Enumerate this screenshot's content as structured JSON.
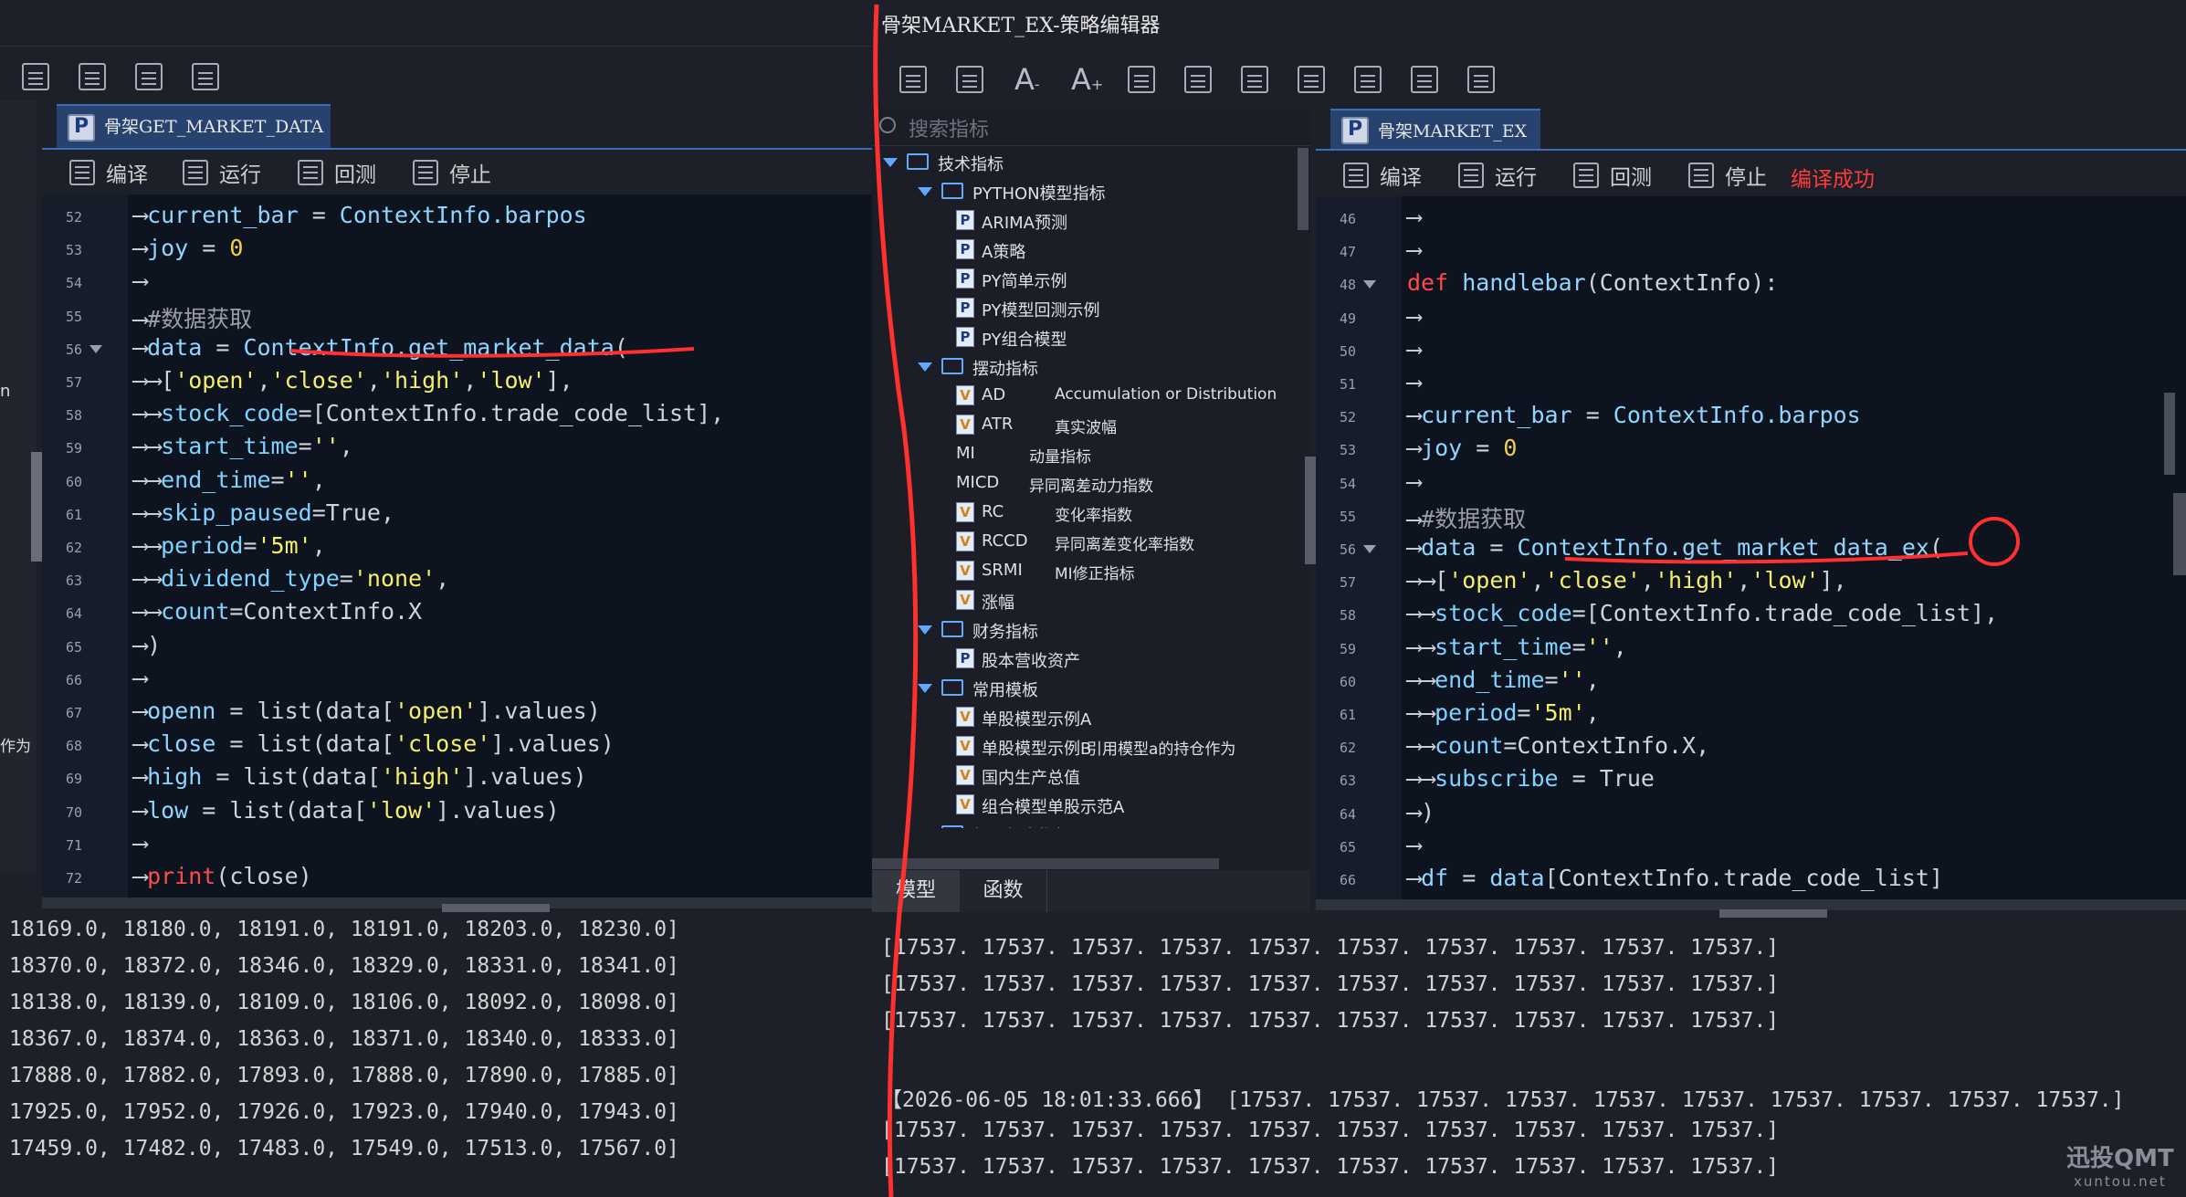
{
  "left_window": {
    "tab_label": "骨架GET_MARKET_DATA",
    "toolbar": [
      "编译",
      "运行",
      "回测",
      "停止"
    ],
    "side_fragments": [
      "n",
      "作为"
    ],
    "code_lines": [
      {
        "n": "52",
        "t": [
          [
            "arr",
            "⟶"
          ],
          [
            "var",
            "current_bar"
          ],
          [
            "",
            " = "
          ],
          [
            "var",
            "ContextInfo.barpos"
          ]
        ]
      },
      {
        "n": "53",
        "t": [
          [
            "arr",
            "⟶"
          ],
          [
            "var",
            "joy"
          ],
          [
            "",
            " = "
          ],
          [
            "num",
            "0"
          ]
        ]
      },
      {
        "n": "54",
        "t": [
          [
            "arr",
            "⟶"
          ]
        ]
      },
      {
        "n": "55",
        "t": [
          [
            "arr",
            "⟶"
          ],
          [
            "cmt",
            "#数据获取"
          ]
        ]
      },
      {
        "n": "56",
        "t": [
          [
            "arr",
            "⟶"
          ],
          [
            "var",
            "data"
          ],
          [
            "",
            " = "
          ],
          [
            "fn",
            "ContextInfo.get_market_data"
          ],
          [
            "",
            "("
          ]
        ]
      },
      {
        "n": "57",
        "t": [
          [
            "arr",
            "⟶⟶"
          ],
          [
            "",
            "["
          ],
          [
            "str",
            "'open'"
          ],
          [
            "",
            ","
          ],
          [
            "str",
            "'close'"
          ],
          [
            "",
            ","
          ],
          [
            "str",
            "'high'"
          ],
          [
            "",
            ","
          ],
          [
            "str",
            "'low'"
          ],
          [
            "",
            "],"
          ]
        ]
      },
      {
        "n": "58",
        "t": [
          [
            "arr",
            "⟶⟶"
          ],
          [
            "prm",
            "stock_code"
          ],
          [
            "",
            "=[ContextInfo.trade_code_list],"
          ]
        ]
      },
      {
        "n": "59",
        "t": [
          [
            "arr",
            "⟶⟶"
          ],
          [
            "prm",
            "start_time"
          ],
          [
            "",
            "="
          ],
          [
            "str",
            "''"
          ],
          [
            "",
            ","
          ]
        ]
      },
      {
        "n": "60",
        "t": [
          [
            "arr",
            "⟶⟶"
          ],
          [
            "prm",
            "end_time"
          ],
          [
            "",
            "="
          ],
          [
            "str",
            "''"
          ],
          [
            "",
            ","
          ]
        ]
      },
      {
        "n": "61",
        "t": [
          [
            "arr",
            "⟶⟶"
          ],
          [
            "prm",
            "skip_paused"
          ],
          [
            "",
            "=True,"
          ]
        ]
      },
      {
        "n": "62",
        "t": [
          [
            "arr",
            "⟶⟶"
          ],
          [
            "prm",
            "period"
          ],
          [
            "",
            "="
          ],
          [
            "str",
            "'5m'"
          ],
          [
            "",
            ","
          ]
        ]
      },
      {
        "n": "63",
        "t": [
          [
            "arr",
            "⟶⟶"
          ],
          [
            "prm",
            "dividend_type"
          ],
          [
            "",
            "="
          ],
          [
            "str",
            "'none'"
          ],
          [
            "",
            ","
          ]
        ]
      },
      {
        "n": "64",
        "t": [
          [
            "arr",
            "⟶⟶"
          ],
          [
            "prm",
            "count"
          ],
          [
            "",
            "=ContextInfo.X"
          ]
        ]
      },
      {
        "n": "65",
        "t": [
          [
            "arr",
            "⟶"
          ],
          [
            "",
            ")"
          ]
        ]
      },
      {
        "n": "66",
        "t": [
          [
            "arr",
            "⟶"
          ]
        ]
      },
      {
        "n": "67",
        "t": [
          [
            "arr",
            "⟶"
          ],
          [
            "var",
            "openn"
          ],
          [
            "",
            " = list(data["
          ],
          [
            "str",
            "'open'"
          ],
          [
            "",
            "].values)"
          ]
        ]
      },
      {
        "n": "68",
        "t": [
          [
            "arr",
            "⟶"
          ],
          [
            "var",
            "close"
          ],
          [
            "",
            " = list(data["
          ],
          [
            "str",
            "'close'"
          ],
          [
            "",
            "].values)"
          ]
        ]
      },
      {
        "n": "69",
        "t": [
          [
            "arr",
            "⟶"
          ],
          [
            "var",
            "high"
          ],
          [
            "",
            " = list(data["
          ],
          [
            "str",
            "'high'"
          ],
          [
            "",
            "].values)"
          ]
        ]
      },
      {
        "n": "70",
        "t": [
          [
            "arr",
            "⟶"
          ],
          [
            "var",
            "low"
          ],
          [
            "",
            " = list(data["
          ],
          [
            "str",
            "'low'"
          ],
          [
            "",
            "].values)"
          ]
        ]
      },
      {
        "n": "71",
        "t": [
          [
            "arr",
            "⟶"
          ]
        ]
      },
      {
        "n": "72",
        "t": [
          [
            "arr",
            "⟶"
          ],
          [
            "kw",
            "print"
          ],
          [
            "",
            "(close)"
          ]
        ]
      }
    ],
    "output": [
      "18169.0, 18180.0, 18191.0, 18191.0, 18203.0, 18230.0]",
      "18370.0, 18372.0, 18346.0, 18329.0, 18331.0, 18341.0]",
      "18138.0, 18139.0, 18109.0, 18106.0, 18092.0, 18098.0]",
      "18367.0, 18374.0, 18363.0, 18371.0, 18340.0, 18333.0]",
      "17888.0, 17882.0, 17893.0, 17888.0, 17890.0, 17885.0]",
      "17925.0, 17952.0, 17926.0, 17923.0, 17940.0, 17943.0]",
      "17459.0, 17482.0, 17483.0, 17549.0, 17513.0, 17567.0]"
    ]
  },
  "right_window": {
    "title": "骨架MARKET_EX-策略编辑器",
    "search_placeholder": "搜索指标",
    "tab_label": "骨架MARKET_EX",
    "toolbar": [
      "编译",
      "运行",
      "回测",
      "停止"
    ],
    "compile_status": "编译成功",
    "tree": [
      {
        "level": 0,
        "type": "folder",
        "label": "技术指标"
      },
      {
        "level": 1,
        "type": "folder",
        "label": "PYTHON模型指标"
      },
      {
        "level": 2,
        "type": "p",
        "label": "ARIMA预测"
      },
      {
        "level": 2,
        "type": "p",
        "label": "A策略"
      },
      {
        "level": 2,
        "type": "p",
        "label": "PY简单示例"
      },
      {
        "level": 2,
        "type": "p",
        "label": "PY模型回测示例"
      },
      {
        "level": 2,
        "type": "p",
        "label": "PY组合模型"
      },
      {
        "level": 1,
        "type": "folder",
        "label": "摆动指标"
      },
      {
        "level": 2,
        "type": "v",
        "label": "AD",
        "desc": "Accumulation or Distribution"
      },
      {
        "level": 2,
        "type": "v",
        "label": "ATR",
        "desc": "真实波幅"
      },
      {
        "level": 2,
        "type": "none",
        "label": "MI",
        "desc": "动量指标"
      },
      {
        "level": 2,
        "type": "none",
        "label": "MICD",
        "desc": "异同离差动力指数"
      },
      {
        "level": 2,
        "type": "v",
        "label": "RC",
        "desc": "变化率指数"
      },
      {
        "level": 2,
        "type": "v",
        "label": "RCCD",
        "desc": "异同离差变化率指数"
      },
      {
        "level": 2,
        "type": "v",
        "label": "SRMI",
        "desc": "MI修正指标"
      },
      {
        "level": 2,
        "type": "v",
        "label": "涨幅"
      },
      {
        "level": 1,
        "type": "folder",
        "label": "财务指标"
      },
      {
        "level": 2,
        "type": "p",
        "label": "股本营收资产"
      },
      {
        "level": 1,
        "type": "folder",
        "label": "常用模板"
      },
      {
        "level": 2,
        "type": "v",
        "label": "单股模型示例A"
      },
      {
        "level": 2,
        "type": "v",
        "label": "单股模型示例B",
        "desc": "引用模型a的持仓作为"
      },
      {
        "level": 2,
        "type": "v",
        "label": "国内生产总值"
      },
      {
        "level": 2,
        "type": "v",
        "label": "组合模型单股示范A"
      },
      {
        "level": 1,
        "type": "folder",
        "label": "超买超卖指标"
      }
    ],
    "bottom_tabs": [
      "模型",
      "函数"
    ],
    "code_lines": [
      {
        "n": "46",
        "t": [
          [
            "arr",
            "⟶"
          ]
        ]
      },
      {
        "n": "47",
        "t": [
          [
            "arr",
            "⟶"
          ]
        ]
      },
      {
        "n": "48",
        "t": [
          [
            "kw",
            "def"
          ],
          [
            "",
            " "
          ],
          [
            "fn",
            "handlebar"
          ],
          [
            "",
            "(ContextInfo):"
          ]
        ]
      },
      {
        "n": "49",
        "t": [
          [
            "arr",
            "⟶"
          ]
        ]
      },
      {
        "n": "50",
        "t": [
          [
            "arr",
            "⟶"
          ]
        ]
      },
      {
        "n": "51",
        "t": [
          [
            "arr",
            "⟶"
          ]
        ]
      },
      {
        "n": "52",
        "t": [
          [
            "arr",
            "⟶"
          ],
          [
            "var",
            "current_bar"
          ],
          [
            "",
            " = "
          ],
          [
            "var",
            "ContextInfo.barpos"
          ]
        ]
      },
      {
        "n": "53",
        "t": [
          [
            "arr",
            "⟶"
          ],
          [
            "var",
            "joy"
          ],
          [
            "",
            " = "
          ],
          [
            "num",
            "0"
          ]
        ]
      },
      {
        "n": "54",
        "t": [
          [
            "arr",
            "⟶"
          ]
        ]
      },
      {
        "n": "55",
        "t": [
          [
            "arr",
            "⟶"
          ],
          [
            "cmt",
            "#数据获取"
          ]
        ]
      },
      {
        "n": "56",
        "t": [
          [
            "arr",
            "⟶"
          ],
          [
            "var",
            "data"
          ],
          [
            "",
            " = "
          ],
          [
            "fn",
            "ContextInfo.get_market_data_ex"
          ],
          [
            "",
            "("
          ]
        ]
      },
      {
        "n": "57",
        "t": [
          [
            "arr",
            "⟶⟶"
          ],
          [
            "",
            "["
          ],
          [
            "str",
            "'open'"
          ],
          [
            "",
            ","
          ],
          [
            "str",
            "'close'"
          ],
          [
            "",
            ","
          ],
          [
            "str",
            "'high'"
          ],
          [
            "",
            ","
          ],
          [
            "str",
            "'low'"
          ],
          [
            "",
            "],"
          ]
        ]
      },
      {
        "n": "58",
        "t": [
          [
            "arr",
            "⟶⟶"
          ],
          [
            "prm",
            "stock_code"
          ],
          [
            "",
            "=[ContextInfo.trade_code_list],"
          ]
        ]
      },
      {
        "n": "59",
        "t": [
          [
            "arr",
            "⟶⟶"
          ],
          [
            "prm",
            "start_time"
          ],
          [
            "",
            "="
          ],
          [
            "str",
            "''"
          ],
          [
            "",
            ","
          ]
        ]
      },
      {
        "n": "60",
        "t": [
          [
            "arr",
            "⟶⟶"
          ],
          [
            "prm",
            "end_time"
          ],
          [
            "",
            "="
          ],
          [
            "str",
            "''"
          ],
          [
            "",
            ","
          ]
        ]
      },
      {
        "n": "61",
        "t": [
          [
            "arr",
            "⟶⟶"
          ],
          [
            "prm",
            "period"
          ],
          [
            "",
            "="
          ],
          [
            "str",
            "'5m'"
          ],
          [
            "",
            ","
          ]
        ]
      },
      {
        "n": "62",
        "t": [
          [
            "arr",
            "⟶⟶"
          ],
          [
            "prm",
            "count"
          ],
          [
            "",
            "=ContextInfo.X,"
          ]
        ]
      },
      {
        "n": "63",
        "t": [
          [
            "arr",
            "⟶⟶"
          ],
          [
            "prm",
            "subscribe"
          ],
          [
            "",
            " = True"
          ]
        ]
      },
      {
        "n": "64",
        "t": [
          [
            "arr",
            "⟶"
          ],
          [
            "",
            ")"
          ]
        ]
      },
      {
        "n": "65",
        "t": [
          [
            "arr",
            "⟶"
          ]
        ]
      },
      {
        "n": "66",
        "t": [
          [
            "arr",
            "⟶"
          ],
          [
            "var",
            "df"
          ],
          [
            "",
            " = "
          ],
          [
            "var",
            "data"
          ],
          [
            "",
            "[ContextInfo.trade_code_list]"
          ]
        ]
      }
    ],
    "output": [
      "[17537. 17537. 17537. 17537. 17537. 17537. 17537. 17537. 17537. 17537.]",
      "[17537. 17537. 17537. 17537. 17537. 17537. 17537. 17537. 17537. 17537.]",
      "[17537. 17537. 17537. 17537. 17537. 17537. 17537. 17537. 17537. 17537.]",
      "",
      "【2026-06-05 18:01:33.666】 [17537. 17537. 17537. 17537. 17537. 17537. 17537. 17537. 17537. 17537.]",
      "[17537. 17537. 17537. 17537. 17537. 17537. 17537. 17537. 17537. 17537.]",
      "[17537. 17537. 17537. 17537. 17537. 17537. 17537. 17537. 17537. 17537.]"
    ]
  },
  "watermark": {
    "main": "迅投QMT",
    "sub": "xuntou.net"
  },
  "colors": {
    "annotation": "#ff3030",
    "accent_tab": "#27426f",
    "status_red": "#ff3b3b"
  }
}
